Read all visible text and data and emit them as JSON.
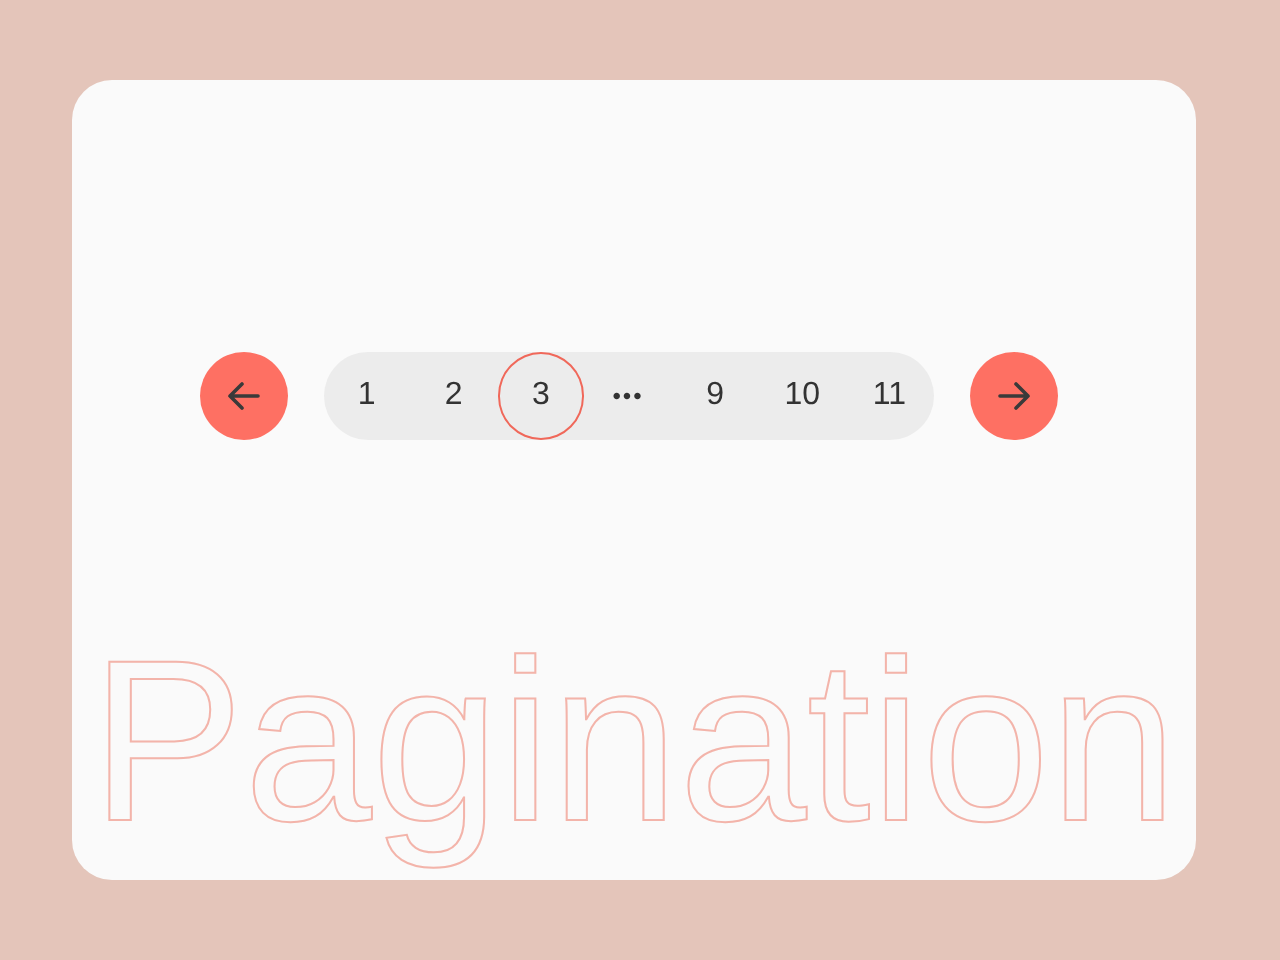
{
  "pagination": {
    "pages": [
      {
        "kind": "page",
        "label": "1",
        "selected": false
      },
      {
        "kind": "page",
        "label": "2",
        "selected": false
      },
      {
        "kind": "page",
        "label": "3",
        "selected": true
      },
      {
        "kind": "ellipsis",
        "label": "•••"
      },
      {
        "kind": "page",
        "label": "9",
        "selected": false
      },
      {
        "kind": "page",
        "label": "10",
        "selected": false
      },
      {
        "kind": "page",
        "label": "11",
        "selected": false
      }
    ]
  },
  "title": "Pagination"
}
